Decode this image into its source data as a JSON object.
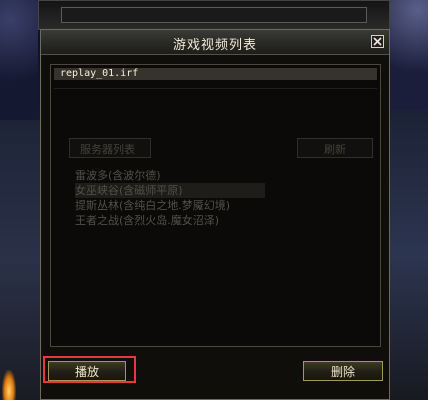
{
  "dialog": {
    "title": "游戏视频列表",
    "close_icon": "close-icon"
  },
  "replay_list": {
    "items": [
      "replay_01.irf"
    ]
  },
  "server_list": {
    "header_label": "服务器列表",
    "refresh_label": "刷新",
    "items": [
      "雷波多(含波尔德)",
      "女巫峡谷(含磁师平原)",
      "提斯丛林(含纯白之地.梦魇幻境)",
      "王者之战(含烈火岛.魔女沼泽)"
    ]
  },
  "buttons": {
    "play_label": "播放",
    "delete_label": "删除"
  },
  "colors": {
    "highlight": "#e23b3b",
    "button_border": "#a6955c",
    "title_text": "#f1ead6"
  }
}
